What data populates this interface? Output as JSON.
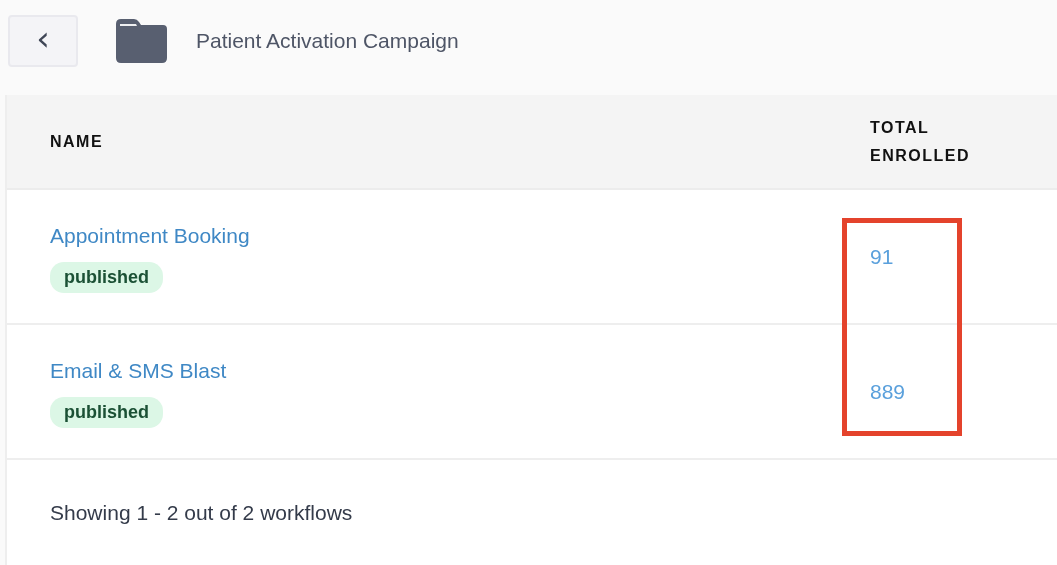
{
  "header": {
    "back_button": "‹",
    "title": "Patient Activation Campaign"
  },
  "table": {
    "columns": [
      {
        "label": "NAME"
      },
      {
        "label": "TOTAL ENROLLED",
        "highlighted": true
      }
    ],
    "rows": [
      {
        "name": "Appointment Booking",
        "status": "published",
        "total_enrolled": "91"
      },
      {
        "name": "Email & SMS Blast",
        "status": "published",
        "total_enrolled": "889"
      }
    ]
  },
  "footer": "Showing 1 - 2 out of 2 workflows"
}
